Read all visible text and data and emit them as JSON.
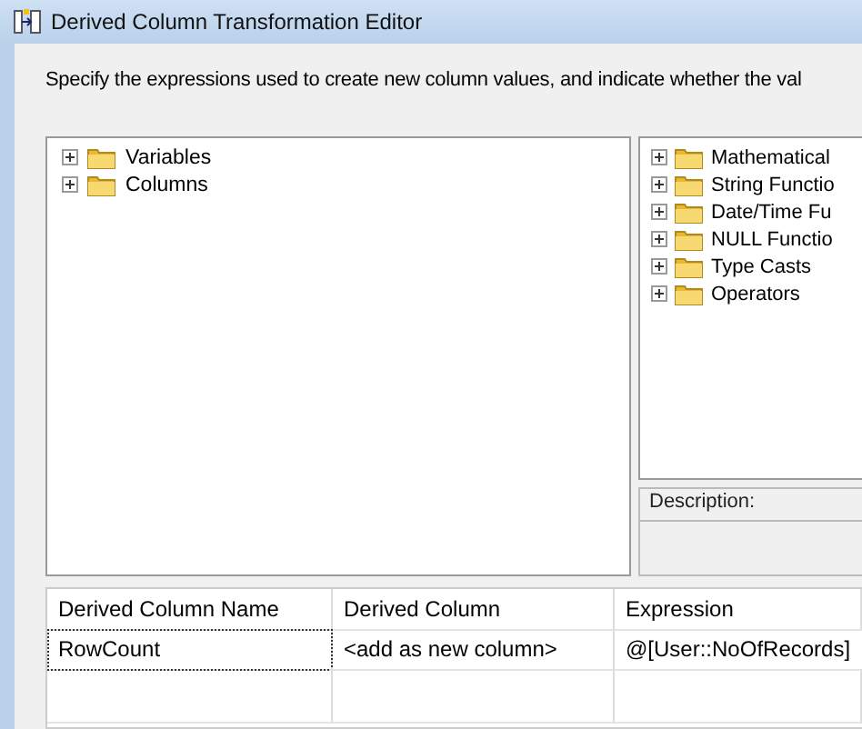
{
  "window": {
    "title": "Derived Column Transformation Editor"
  },
  "instructions": "Specify the expressions used to create new column values, and indicate whether the val",
  "variables_tree": [
    {
      "label": "Variables",
      "expanded": false
    },
    {
      "label": "Columns",
      "expanded": false
    }
  ],
  "functions_tree": [
    {
      "label": "Mathematical",
      "expanded": false
    },
    {
      "label": "String Functio",
      "expanded": false
    },
    {
      "label": "Date/Time Fu",
      "expanded": false
    },
    {
      "label": "NULL Functio",
      "expanded": false
    },
    {
      "label": "Type Casts",
      "expanded": false
    },
    {
      "label": "Operators",
      "expanded": false
    }
  ],
  "description": {
    "label": "Description:"
  },
  "grid": {
    "columns": [
      "Derived Column Name",
      "Derived Column",
      "Expression"
    ],
    "rows": [
      {
        "cells": [
          "RowCount",
          "<add as new column>",
          "@[User::NoOfRecords]"
        ],
        "focused": true
      }
    ]
  }
}
